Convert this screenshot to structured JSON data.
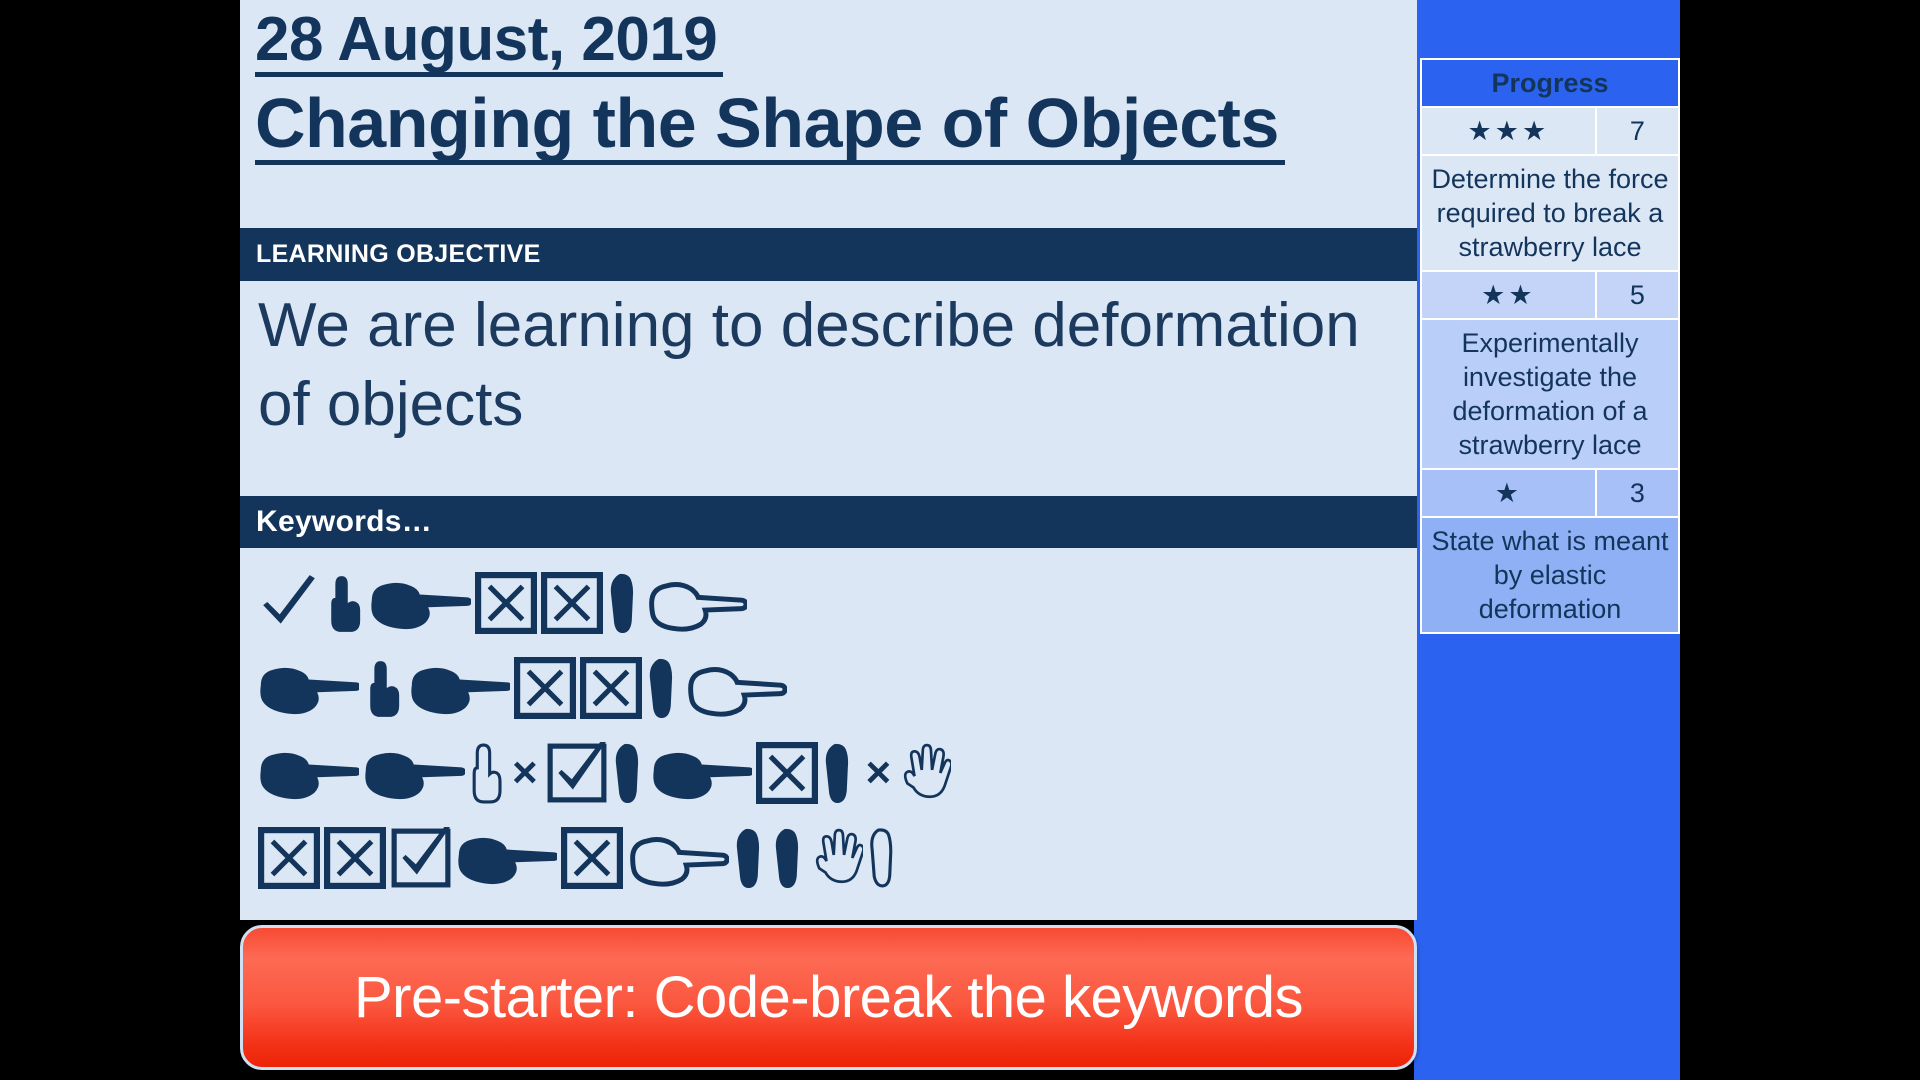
{
  "slide": {
    "date": "28 August, 2019",
    "topic": "Changing the Shape of Objects",
    "learning_objective_label": "LEARNING OBJECTIVE",
    "learning_objective_text": "We are learning to describe deformation of objects",
    "keywords_label": "Keywords…",
    "prestarter_label": "Pre-starter: Code-break the keywords"
  },
  "keywords_cipher": {
    "description": "Four rows of Wingdings-style symbol glyphs forming a keyword code puzzle",
    "rows": [
      [
        "check-mark-icon",
        "hand-point-up-icon",
        "hand-point-right-filled-icon",
        "boxed-x-icon",
        "boxed-x-icon",
        "hand-point-down-filled-icon",
        "hand-point-right-outline-icon"
      ],
      [
        "hand-point-right-filled-icon",
        "hand-point-up-icon",
        "hand-point-right-filled-icon",
        "boxed-x-icon",
        "boxed-x-icon",
        "hand-point-down-filled-icon",
        "hand-point-right-outline-icon"
      ],
      [
        "hand-point-right-filled-icon",
        "hand-point-right-filled-icon",
        "hand-point-up-outline-icon",
        "x-mark-icon",
        "boxed-check-icon",
        "hand-point-down-filled-icon",
        "hand-point-right-filled-icon",
        "boxed-x-icon",
        "hand-point-down-filled-icon",
        "x-mark-icon",
        "open-palm-outline-icon"
      ],
      [
        "boxed-x-icon",
        "boxed-x-icon",
        "boxed-check-icon",
        "hand-point-right-filled-icon",
        "boxed-x-icon",
        "hand-point-right-outline-icon",
        "hand-point-down-filled-icon",
        "hand-point-down-filled-icon",
        "open-palm-outline-icon",
        "hand-point-down-outline-icon"
      ]
    ],
    "x_symbol": "×"
  },
  "progress": {
    "header": "Progress",
    "levels": [
      {
        "stars": "★★★",
        "score": "7",
        "description": "Determine the force required to break a strawberry lace"
      },
      {
        "stars": "★★",
        "score": "5",
        "description": "Experimentally investigate the deformation of a strawberry lace"
      },
      {
        "stars": "★",
        "score": "3",
        "description": "State what is meant by elastic deformation"
      }
    ]
  },
  "colors": {
    "navy": "#14355B",
    "light_blue": "#DCE7F5",
    "accent_blue": "#2B63F0",
    "red": "#F8422A"
  }
}
